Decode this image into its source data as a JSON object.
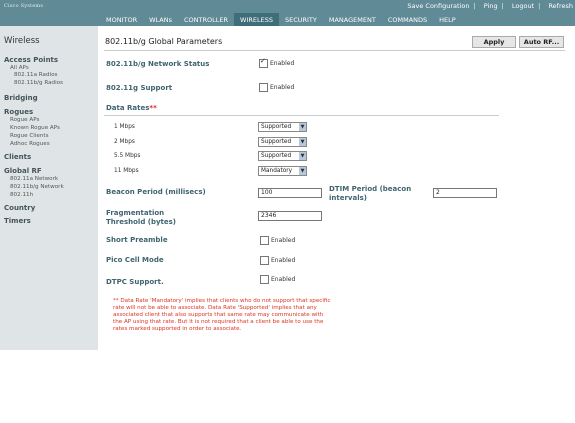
{
  "brand": {
    "logo_text": "Cisco Systems"
  },
  "top_links": [
    "Save Configuration",
    "Ping",
    "Logout",
    "Refresh"
  ],
  "nav": [
    "MONITOR",
    "WLANs",
    "CONTROLLER",
    "WIRELESS",
    "SECURITY",
    "MANAGEMENT",
    "COMMANDS",
    "HELP"
  ],
  "nav_active": "WIRELESS",
  "sidebar": {
    "title": "Wireless",
    "access_points": "Access Points",
    "all_aps": "All APs",
    "radios_a": "802.11a Radios",
    "radios_bg": "802.11b/g Radios",
    "bridging": "Bridging",
    "rogues": "Rogues",
    "rogue_aps": "Rogue APs",
    "known_rogue_aps": "Known Rogue APs",
    "rogue_clients": "Rogue Clients",
    "adhoc_rogues": "Adhoc Rogues",
    "clients": "Clients",
    "global_rf": "Global RF",
    "net_a": "802.11a Network",
    "net_bg": "802.11b/g Network",
    "net_h": "802.11h",
    "country": "Country",
    "timers": "Timers"
  },
  "page": {
    "title": "802.11b/g Global Parameters",
    "apply": "Apply",
    "auto_rf": "Auto RF..."
  },
  "form": {
    "network_status_label": "802.11b/g Network Status",
    "network_status_enabled": true,
    "support_label": "802.11g Support",
    "support_enabled": false,
    "enabled_text": "Enabled",
    "data_rates_label": "Data Rates**",
    "rates": [
      {
        "label": "1 Mbps",
        "value": "Supported"
      },
      {
        "label": "2 Mbps",
        "value": "Supported"
      },
      {
        "label": "5.5 Mbps",
        "value": "Supported"
      },
      {
        "label": "11 Mbps",
        "value": "Mandatory"
      }
    ],
    "beacon_label": "Beacon Period (millisecs)",
    "beacon_value": "100",
    "dtim_label_1": "DTIM Period (beacon",
    "dtim_label_2": "intervals)",
    "dtim_value": "2",
    "frag_label_1": "Fragmentation",
    "frag_label_2": "Threshold (bytes)",
    "frag_value": "2346",
    "short_preamble_label": "Short Preamble",
    "short_preamble_enabled": false,
    "pico_label": "Pico Cell Mode",
    "pico_enabled": false,
    "dtpc_label": "DTPC Support.",
    "dtpc_enabled": false
  },
  "footnote": "** Data Rate 'Mandatory' implies that clients who do not support that specific rate will not be able to associate. Data Rate 'Supported' implies that any associated client that also supports that same rate may communicate with the AP using that rate. But it is not required that a client be able to use the rates marked supported in order to associate."
}
